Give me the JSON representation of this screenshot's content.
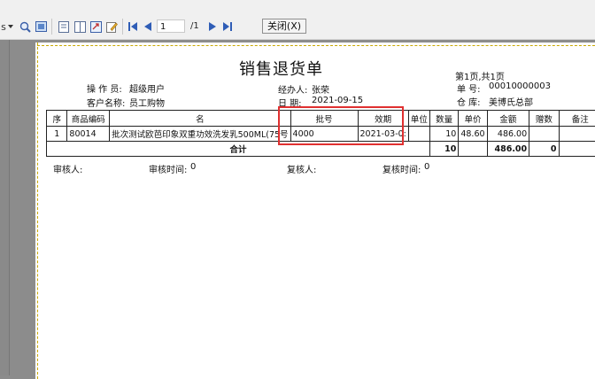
{
  "toolbar": {
    "first_label": "s",
    "page_value": "1",
    "page_total": "/1",
    "close_label": "关闭(X)",
    "icons": [
      "dropdown-icon",
      "zoom-icon",
      "page-view-icon",
      "single-page-icon",
      "two-page-icon",
      "export-icon",
      "edit-icon",
      "first-page-icon",
      "prev-page-icon",
      "next-page-icon",
      "last-page-icon"
    ]
  },
  "doc": {
    "title": "销售退货单",
    "page_info": "第1页,共1页",
    "operator_label": "操 作 员:",
    "operator": "超级用户",
    "customer_label": "客户名称:",
    "customer": "员工购物",
    "handler_label": "经办人:",
    "handler": "张荣",
    "date_label": "日  期:",
    "date": "2021-09-15",
    "order_label": "单  号:",
    "order_no": "00010000003",
    "warehouse_label": "仓  库:",
    "warehouse": "美博氏总部"
  },
  "table": {
    "headers": [
      "序",
      "商品编码",
      "名",
      "批号",
      "效期",
      "单位",
      "数量",
      "单价",
      "金额",
      "赠数",
      "备注"
    ],
    "rows": [
      [
        "1",
        "80014",
        "批次测试欧芭印象双重功效洗发乳500ML(75号",
        "4000",
        "2021-03-0:",
        "",
        "10",
        "48.60",
        "486.00",
        "",
        ""
      ]
    ],
    "total_label": "合计",
    "total_qty": "10",
    "total_amount": "486.00",
    "total_gift": "0"
  },
  "footer": {
    "reviewer_label": "审核人:",
    "review_time_label": "审核时间:",
    "review_time": "0",
    "rechecker_label": "复核人:",
    "recheck_time_label": "复核时间:",
    "recheck_time": "0"
  },
  "colors": {
    "highlight": "#e03030",
    "toolbar_bg": "#f0f0f0",
    "backdrop": "#8c8c8c"
  }
}
